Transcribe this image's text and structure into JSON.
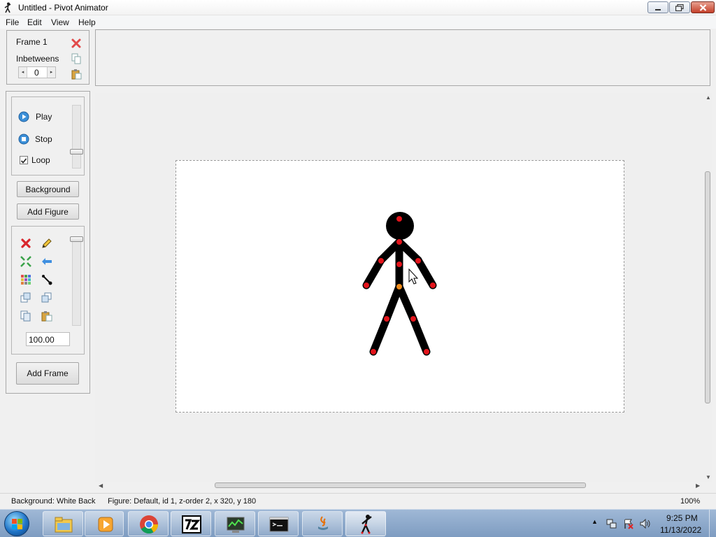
{
  "window": {
    "title": "Untitled - Pivot Animator",
    "minimize_icon": "minimize-icon",
    "maximize_icon": "restore-icon",
    "close_icon": "close-icon"
  },
  "menu": [
    "File",
    "Edit",
    "View",
    "Help"
  ],
  "frame_panel": {
    "frame_label": "Frame 1",
    "inbetweens_label": "Inbetweens",
    "inbetweens_value": "0"
  },
  "playback": {
    "play_label": "Play",
    "stop_label": "Stop",
    "loop_label": "Loop",
    "loop_checked": true
  },
  "buttons": {
    "background": "Background",
    "add_figure": "Add Figure",
    "add_frame": "Add Frame"
  },
  "figure_tools": {
    "scale_value": "100.00"
  },
  "status": {
    "background": "Background: White Back",
    "figure": "Figure: Default,  id 1,  z-order 2,  x 320, y 180",
    "zoom": "100%"
  },
  "taskbar": {
    "apps": [
      "windows-explorer-icon",
      "media-player-icon",
      "chrome-icon",
      "7zip-icon",
      "task-manager-icon",
      "command-prompt-icon",
      "java-icon",
      "pivot-animator-icon"
    ],
    "time": "9:25 PM",
    "date": "11/13/2022"
  },
  "colors": {
    "joint_red": "#e3141b",
    "joint_orange": "#f08c1a",
    "figure_black": "#000000"
  }
}
